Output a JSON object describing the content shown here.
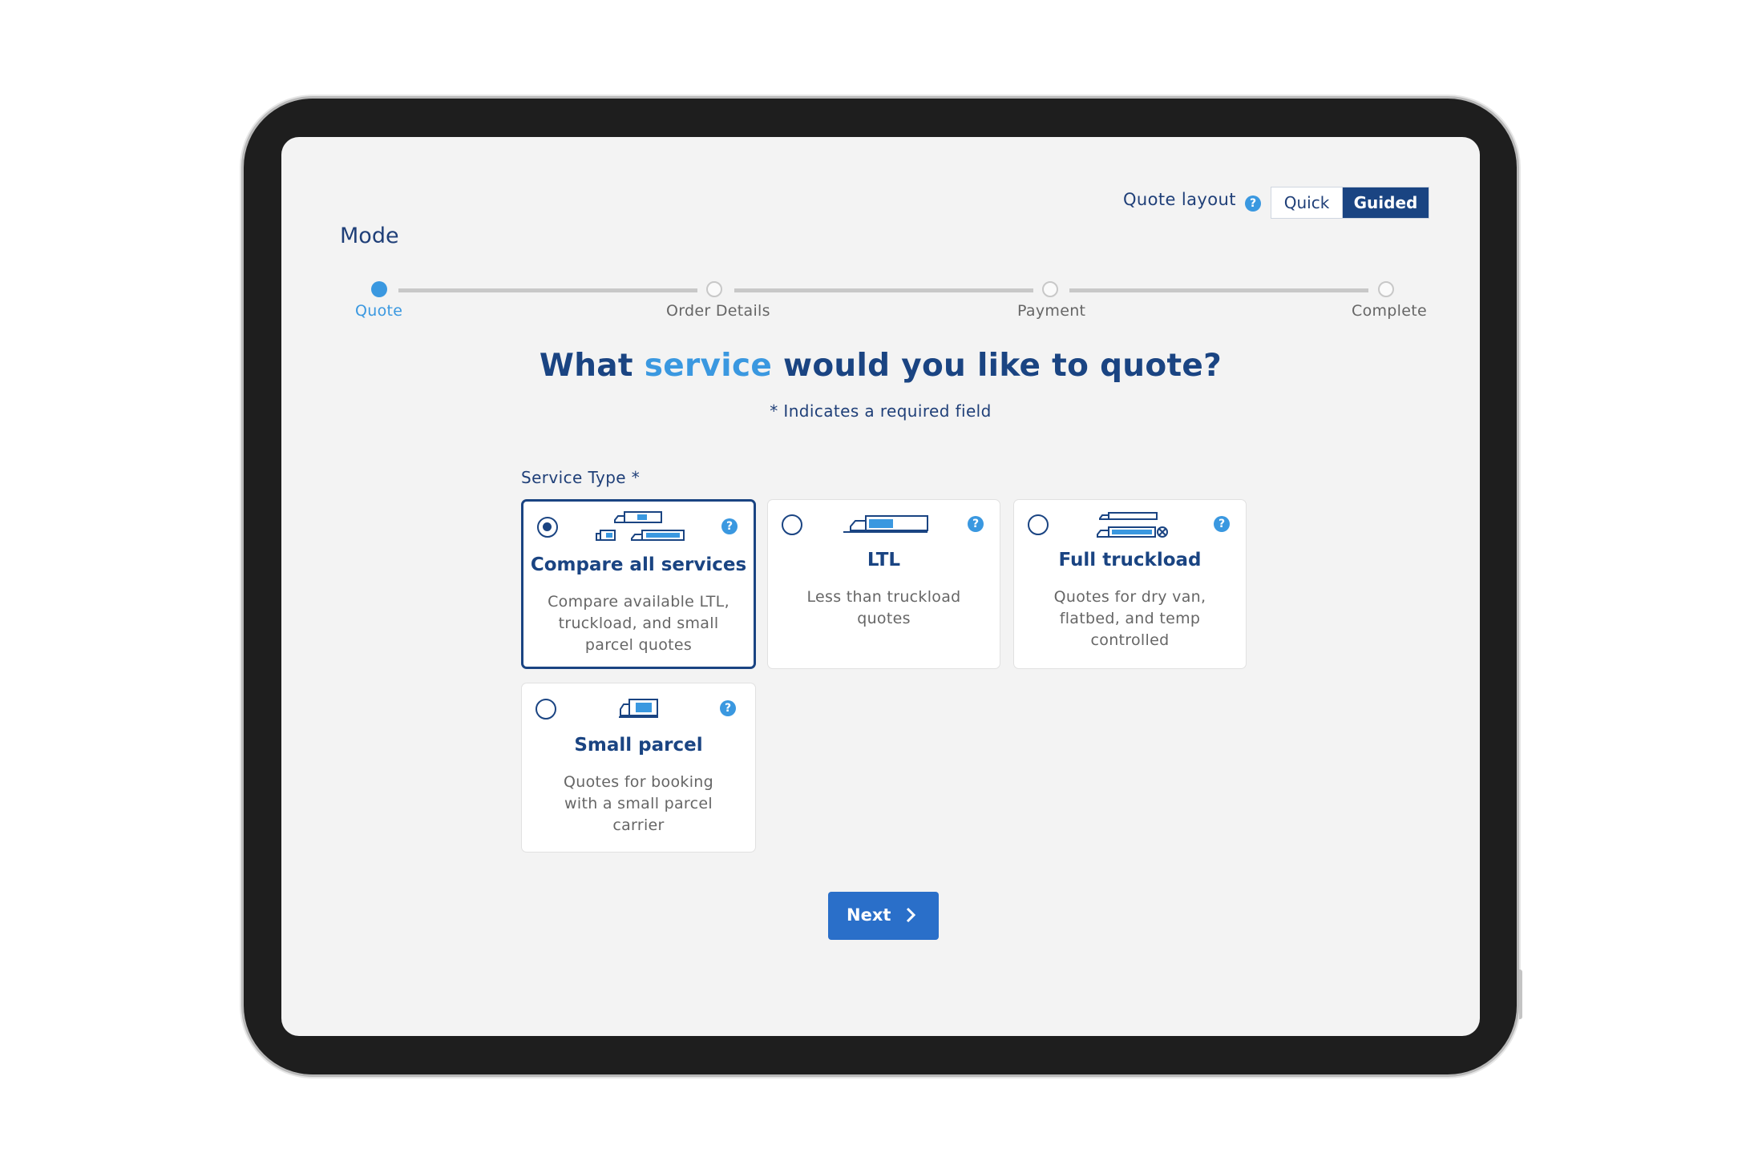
{
  "header": {
    "quote_layout_label": "Quote layout",
    "toggle": {
      "quick": "Quick",
      "guided": "Guided",
      "selected": "Guided"
    }
  },
  "page": {
    "section_title": "Mode"
  },
  "stepper": {
    "steps": [
      {
        "label": "Quote",
        "state": "active"
      },
      {
        "label": "Order Details",
        "state": "pending"
      },
      {
        "label": "Payment",
        "state": "pending"
      },
      {
        "label": "Complete",
        "state": "pending"
      }
    ]
  },
  "question": {
    "prefix": "What ",
    "highlight": "service",
    "suffix": " would you like to quote?",
    "required_note": "* Indicates a required field"
  },
  "service_type": {
    "label": "Service Type *",
    "selected": "Compare all services",
    "options": [
      {
        "title": "Compare all services",
        "description": "Compare available LTL, truckload, and small parcel quotes",
        "icon": "multi-vehicle-icon"
      },
      {
        "title": "LTL",
        "description": "Less than truckload quotes",
        "icon": "ltl-truck-icon"
      },
      {
        "title": "Full truckload",
        "description": "Quotes for dry van, flatbed, and temp controlled",
        "icon": "full-truckload-icon"
      },
      {
        "title": "Small parcel",
        "description": "Quotes for booking with a small parcel carrier",
        "icon": "parcel-van-icon"
      }
    ]
  },
  "actions": {
    "next_label": "Next"
  },
  "colors": {
    "primary": "#1a4482",
    "accent": "#3a98e0",
    "button": "#2a6fc9"
  }
}
